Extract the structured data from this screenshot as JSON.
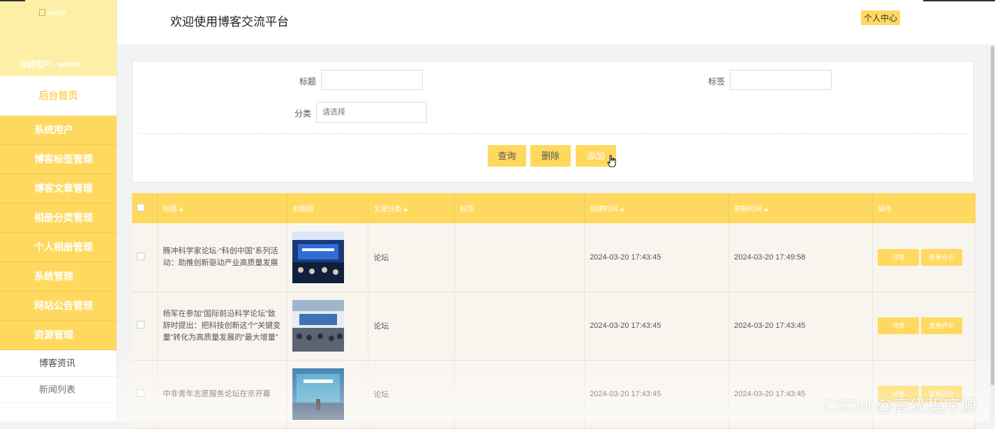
{
  "sidebar": {
    "avatar_alt": "avatar",
    "current_user": "当前用户：admin",
    "home": "后台首页",
    "items": [
      {
        "label": "系统用户"
      },
      {
        "label": "博客标签管理"
      },
      {
        "label": "博客文章管理"
      },
      {
        "label": "相册分类管理"
      },
      {
        "label": "个人相册管理"
      },
      {
        "label": "系统管理"
      },
      {
        "label": "网站公告管理"
      },
      {
        "label": "资源管理"
      }
    ],
    "sub_items": [
      {
        "label": "博客资讯"
      },
      {
        "label": "新闻列表"
      }
    ]
  },
  "header": {
    "title": "欢迎使用博客交流平台",
    "profile": "个人中心"
  },
  "search": {
    "title_label": "标题",
    "title_value": "",
    "tag_label": "标签",
    "tag_value": "",
    "category_label": "分类",
    "category_placeholder": "请选择",
    "query": "查询",
    "delete": "删除",
    "add": "添加"
  },
  "table": {
    "headers": {
      "title": "标题",
      "cover": "封面图",
      "category": "文章分类",
      "tag": "标签",
      "created": "创建时间",
      "updated": "更新时间",
      "actions": "操作"
    },
    "detail_label": "详情",
    "comments_label": "查看评论",
    "rows": [
      {
        "title": "腾冲科学家论坛·“科创中国”系列活动：助推创新驱动产业高质量发展",
        "category": "论坛",
        "tag": "",
        "created": "2024-03-20 17:43:45",
        "updated": "2024-03-20 17:49:58"
      },
      {
        "title": "杨军在参加“国际前沿科学论坛”致辞时提出：把科技创新这个“关键变量”转化为高质量发展的“最大增量”",
        "category": "论坛",
        "tag": "",
        "created": "2024-03-20 17:43:45",
        "updated": "2024-03-20 17:43:45"
      },
      {
        "title": "中非青年志愿服务论坛在京开幕",
        "category": "论坛",
        "tag": "",
        "created": "2024-03-20 17:43:45",
        "updated": "2024-03-20 17:43:45"
      }
    ]
  },
  "watermark": "CSDN @高级程序源"
}
